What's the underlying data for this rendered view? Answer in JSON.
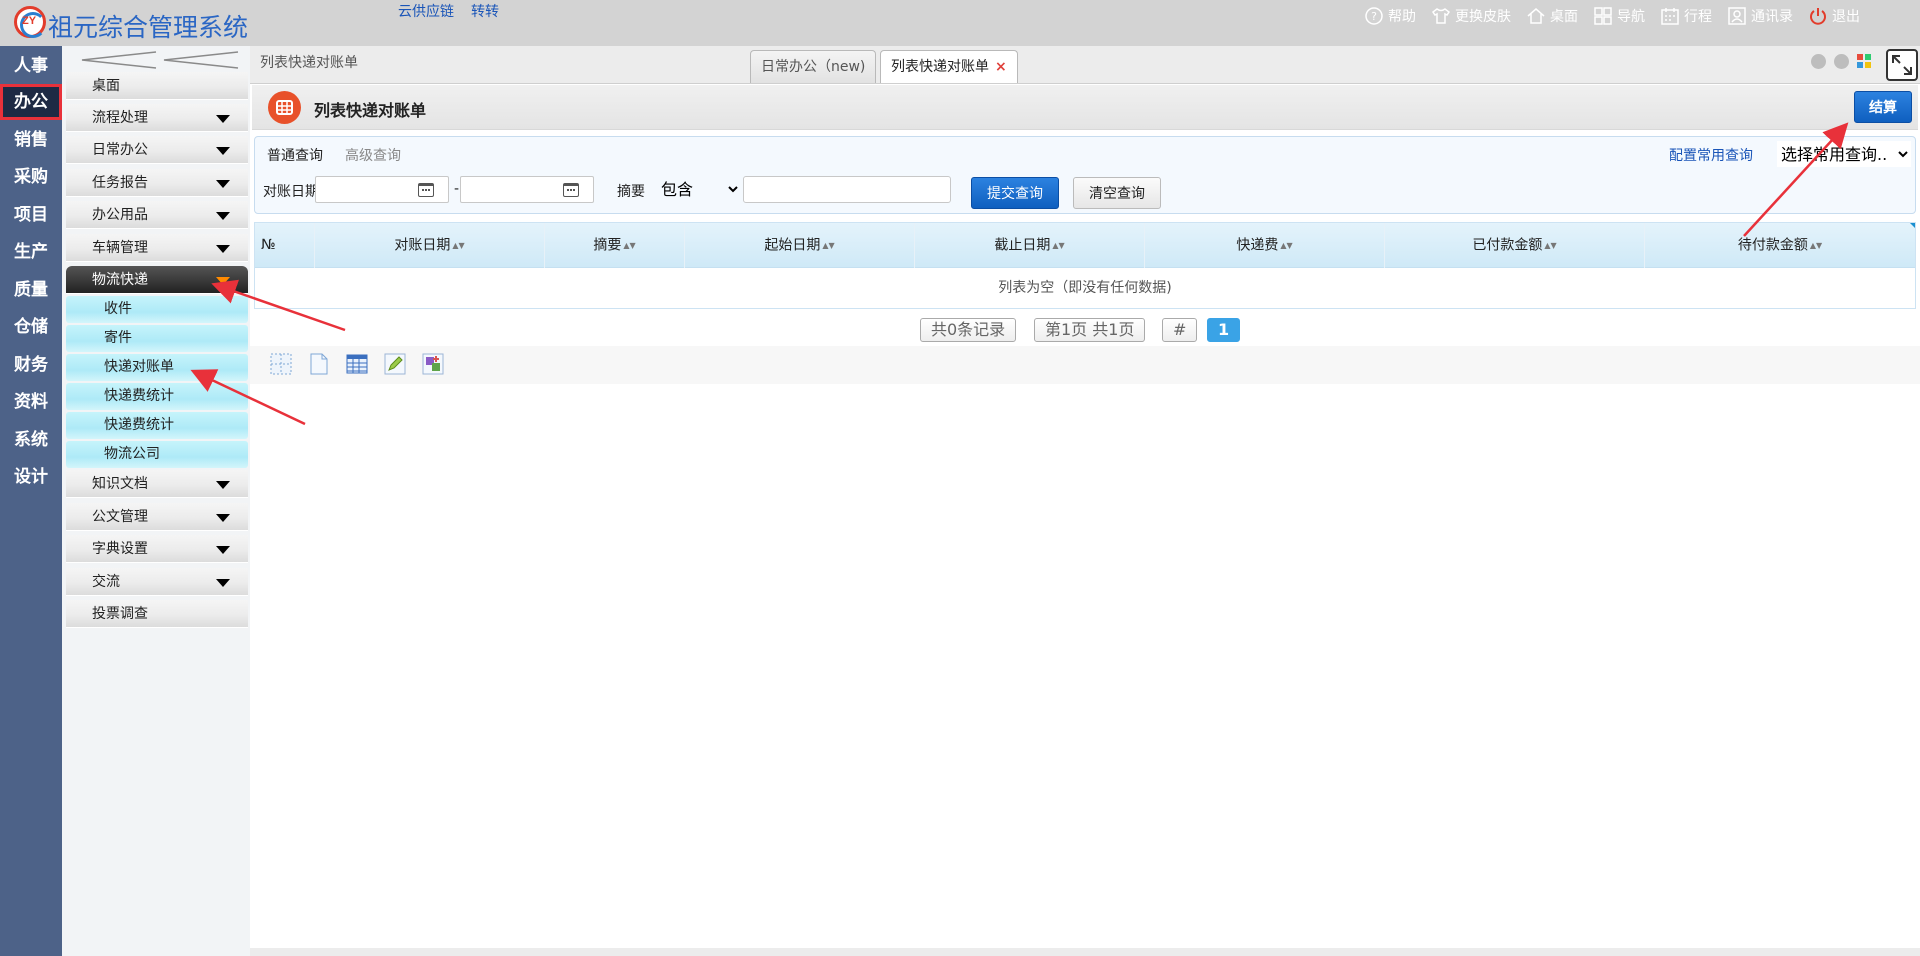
{
  "app": {
    "title": "祖元综合管理系统",
    "logo_text": "ZY",
    "top_links": [
      "云供应链",
      "转转"
    ],
    "tools": [
      {
        "label": "帮助",
        "icon": "help-icon"
      },
      {
        "label": "更换皮肤",
        "icon": "shirt-icon"
      },
      {
        "label": "桌面",
        "icon": "home-icon"
      },
      {
        "label": "导航",
        "icon": "grid-icon"
      },
      {
        "label": "行程",
        "icon": "calendar-icon"
      },
      {
        "label": "通讯录",
        "icon": "contacts-icon"
      },
      {
        "label": "退出",
        "icon": "power-icon"
      }
    ]
  },
  "modules": [
    "人事",
    "办公",
    "销售",
    "采购",
    "项目",
    "生产",
    "质量",
    "仓储",
    "财务",
    "资料",
    "系统",
    "设计"
  ],
  "active_module": "办公",
  "menu": {
    "items": [
      {
        "label": "桌面",
        "caret": false
      },
      {
        "label": "流程处理",
        "caret": true
      },
      {
        "label": "日常办公",
        "caret": true
      },
      {
        "label": "任务报告",
        "caret": true
      },
      {
        "label": "办公用品",
        "caret": true
      },
      {
        "label": "车辆管理",
        "caret": true
      },
      {
        "label": "物流快递",
        "caret": true,
        "active": true
      },
      {
        "label": "知识文档",
        "caret": true
      },
      {
        "label": "公文管理",
        "caret": true
      },
      {
        "label": "字典设置",
        "caret": true
      },
      {
        "label": "交流",
        "caret": true
      },
      {
        "label": "投票调查",
        "caret": false
      }
    ],
    "sub_items": [
      "收件",
      "寄件",
      "快递对账单",
      "快递费统计",
      "快递费统计",
      "物流公司"
    ]
  },
  "tabs": {
    "breadcrumb": "列表快递对账单",
    "list": [
      {
        "label": "日常办公（new)",
        "active": false
      },
      {
        "label": "列表快递对账单",
        "active": true,
        "close": "×"
      }
    ]
  },
  "page": {
    "title": "列表快递对账单",
    "settle_label": "结算"
  },
  "query": {
    "tab_normal": "普通查询",
    "tab_advanced": "高级查询",
    "config_link": "配置常用查询",
    "common_select": "选择常用查询..",
    "date_label": "对账日期",
    "date_sep": "-",
    "summary_label": "摘要",
    "operator": "包含",
    "keyword_value": "",
    "submit_label": "提交查询",
    "clear_label": "清空查询"
  },
  "grid": {
    "columns": [
      "№",
      "对账日期",
      "摘要",
      "起始日期",
      "截止日期",
      "快递费",
      "已付款金额",
      "待付款金额"
    ],
    "empty_text": "列表为空（即没有任何数据)"
  },
  "pager": {
    "total": "共0条记录",
    "pages": "第1页 共1页",
    "hash": "#",
    "current": "1"
  },
  "colors": {
    "module_bg": "#4d6288",
    "primary_button": "#1565c8",
    "active_border": "#e8313a",
    "annotation": "#e8313a"
  }
}
